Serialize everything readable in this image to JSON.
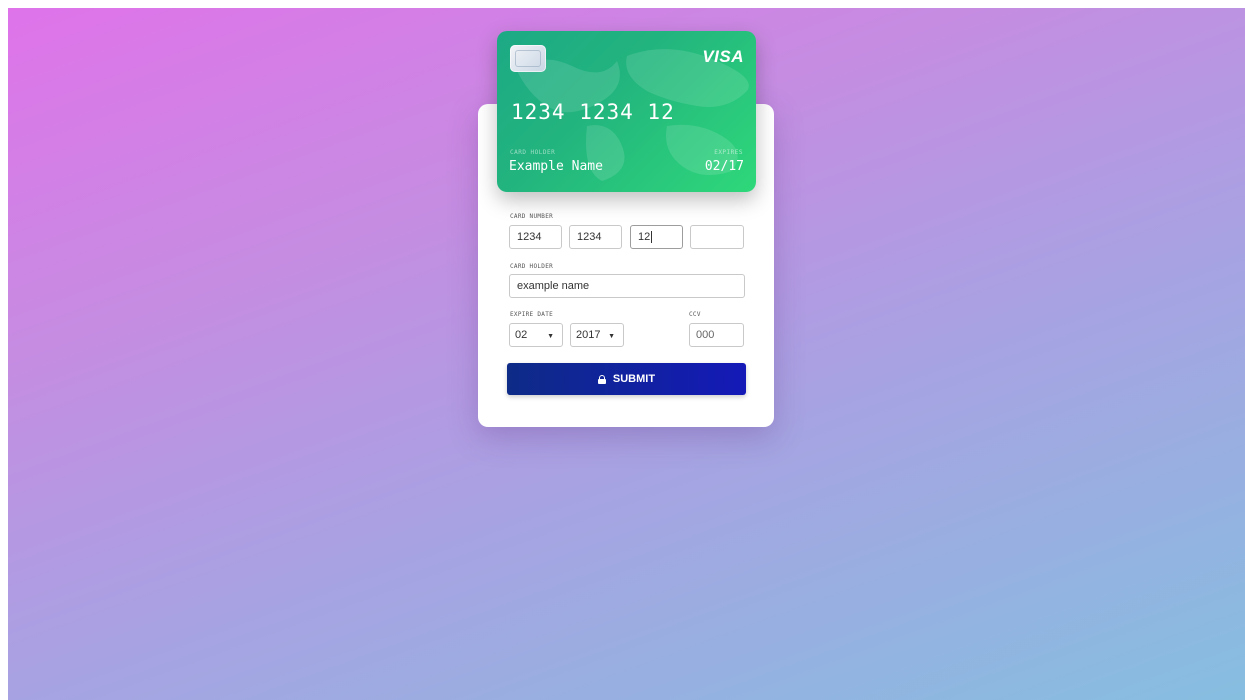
{
  "card": {
    "brand": "VISA",
    "number_display": "1234 1234 12",
    "holder_caption": "CARD HOLDER",
    "holder_name": "Example Name",
    "expires_caption": "EXPIRES",
    "expiry": "02/17"
  },
  "form": {
    "card_number_label": "CARD NUMBER",
    "card_number_fields": [
      "1234",
      "1234",
      "12",
      ""
    ],
    "card_holder_label": "CARD HOLDER",
    "card_holder_value": "example name",
    "expire_date_label": "EXPIRE DATE",
    "expire_month": "02",
    "expire_year": "2017",
    "ccv_label": "CCV",
    "ccv_value": "000",
    "submit_label": "SUBMIT"
  },
  "colors": {
    "card_gradient_start": "#1ca985",
    "card_gradient_end": "#2fd87a",
    "submit_start": "#0e2b87",
    "submit_end": "#1419b7"
  },
  "icons": {
    "chip": "card-chip-icon",
    "submit": "lock-icon",
    "select": "triangle-down-icon"
  }
}
